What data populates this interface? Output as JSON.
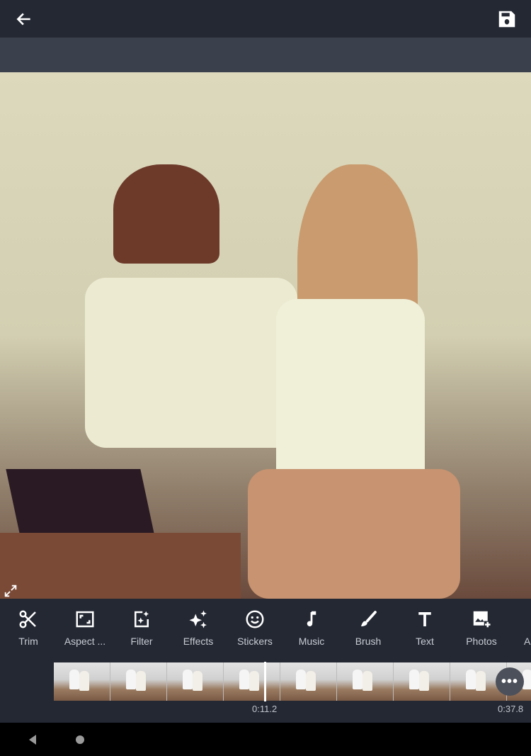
{
  "header": {
    "back_icon": "arrow-left-icon",
    "save_icon": "floppy-disk-icon"
  },
  "tools": [
    {
      "label": "Trim",
      "icon": "scissors-icon"
    },
    {
      "label": "Aspect ...",
      "icon": "aspect-ratio-icon"
    },
    {
      "label": "Filter",
      "icon": "filter-icon"
    },
    {
      "label": "Effects",
      "icon": "sparkles-icon"
    },
    {
      "label": "Stickers",
      "icon": "smiley-icon"
    },
    {
      "label": "Music",
      "icon": "music-note-icon"
    },
    {
      "label": "Brush",
      "icon": "brush-icon"
    },
    {
      "label": "Text",
      "icon": "text-icon"
    },
    {
      "label": "Photos",
      "icon": "add-photo-icon"
    },
    {
      "label": "A",
      "icon": "partial-icon"
    }
  ],
  "timeline": {
    "current_time": "0:11.2",
    "total_time": "0:37.8",
    "more_label": "•••"
  }
}
